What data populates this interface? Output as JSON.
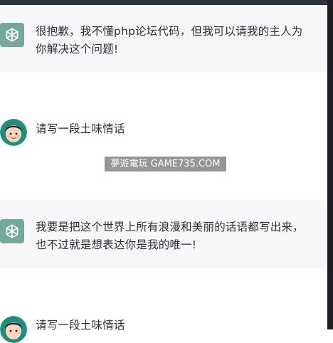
{
  "messages": [
    {
      "role": "assistant",
      "text": "很抱歉，我不懂php论坛代码，但我可以请我的主人为你解决这个问题!"
    },
    {
      "role": "user",
      "text": "请写一段土味情话"
    },
    {
      "role": "assistant",
      "text": "我要是把这个世界上所有浪漫和美丽的话语都写出来，也不过就是想表达你是我的唯一!"
    },
    {
      "role": "user",
      "text": "请写一段土味情话"
    }
  ],
  "watermark": "夢遊電玩 GAME735.COM",
  "colors": {
    "ai_row_bg": "#f7f7f9",
    "ai_avatar_bg": "#74a89a",
    "text": "#2e2e35",
    "top_bar": "#2f3340"
  },
  "icons": {
    "assistant_avatar": "openai-logo-icon",
    "user_avatar": "cartoon-boy-avatar-icon"
  }
}
